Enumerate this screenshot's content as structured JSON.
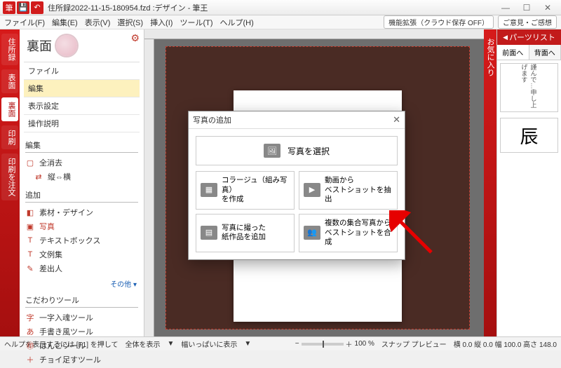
{
  "titlebar": {
    "title": "住所録2022-11-15-180954.fzd :デザイン - 筆王"
  },
  "menubar": {
    "items": [
      "ファイル(F)",
      "編集(E)",
      "表示(V)",
      "選択(S)",
      "挿入(I)",
      "ツール(T)",
      "ヘルプ(H)"
    ],
    "right_ext": "機能拡張（クラウド保存 OFF）",
    "right_feedback": "ご意見・ご感想"
  },
  "rail": {
    "tab1": "住所録",
    "tab2": "表面",
    "tab3": "裏面",
    "tab4": "印刷",
    "tab5": "印刷を注文"
  },
  "side": {
    "heading": "裏面",
    "items": [
      "ファイル",
      "編集",
      "表示設定",
      "操作説明"
    ],
    "sec_edit": "編集",
    "edit_clear": "全消去",
    "edit_orient": "縦⇔横",
    "sec_add": "追加",
    "add_items": [
      "素材・デザイン",
      "写真",
      "テキストボックス",
      "文例集",
      "差出人"
    ],
    "other": "その他",
    "sec_kodawari": "こだわりツール",
    "kodawari": [
      "一字入魂ツール",
      "手書き風ツール",
      "はんこツール",
      "チョイ足すツール"
    ]
  },
  "dialog": {
    "title": "写真の追加",
    "main": "写真を選択",
    "opts": [
      "コラージュ（組み写真）\nを作成",
      "動画から\nベストショットを抽出",
      "写真に撮った\n紙作品を追加",
      "複数の集合写真から\nベストショットを合成"
    ]
  },
  "rightrail": {
    "fav": "お気に入り"
  },
  "parts": {
    "head": "パーツリスト",
    "tab1": "前面へ",
    "tab2": "背面へ",
    "thumb2_char": "辰"
  },
  "status": {
    "help": "ヘルプを表示するには [F1] を押して",
    "view_all": "全体を表示",
    "view_fit": "幅いっぱいに表示",
    "zoom": "100 %",
    "mode": "スナップ プレビュー",
    "coords": "横 0.0 縦 0.0 幅 100.0 高さ 148.0"
  }
}
